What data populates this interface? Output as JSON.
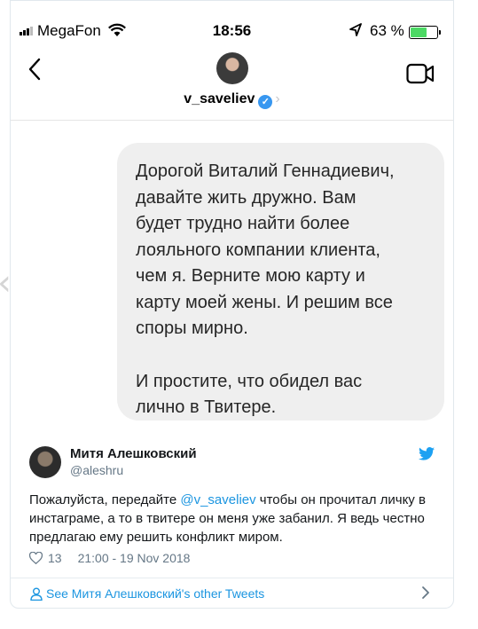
{
  "status_bar": {
    "carrier": "MegaFon",
    "time": "18:56",
    "battery_percent": "63 %",
    "battery_level": 0.63,
    "battery_color": "#4cd964"
  },
  "chat_header": {
    "username": "v_saveliev",
    "verified_icon": "checkmark-icon",
    "back_icon": "chevron-left-icon",
    "video_icon": "video-camera-icon"
  },
  "message": {
    "lines": [
      "Дорогой Виталий Геннадиевич,",
      "давайте жить дружно. Вам",
      "будет трудно найти более",
      "лояльного компании клиента,",
      "чем я. Верните мою карту и",
      "карту моей жены. И решим все",
      "споры мирно."
    ],
    "lines2": [
      "И простите, что обидел вас",
      "лично в Твитере."
    ]
  },
  "tweet": {
    "author_name": "Митя Алешковский",
    "author_handle": "@aleshru",
    "text_before": "Пожалуйста, передайте ",
    "mention": "@v_saveliev",
    "text_after": " чтобы он прочитал личку в инстаграме, а то в твитере он меня уже забанил. Я ведь честно предлагаю ему решить конфликт миром.",
    "likes": "13",
    "timestamp": "21:00 - 19 Nov 2018",
    "see_more": "See Митя Алешковский's other Tweets",
    "accent_color": "#1b95e0"
  }
}
